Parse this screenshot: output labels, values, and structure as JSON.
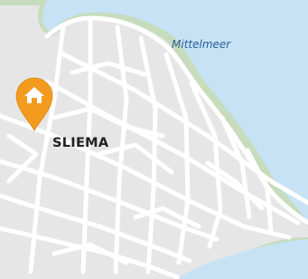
{
  "map": {
    "labels": {
      "sea": "Mittelmeer",
      "town": "SLIEMA"
    },
    "marker": {
      "icon": "home-icon",
      "color": "#f39b1f"
    },
    "colors": {
      "sea": "#c6e2f4",
      "land": "#e6e6e6",
      "coast": "#c6dcbc",
      "roads": "#ffffff",
      "water_label": "#2b5f98",
      "town_label": "#222222"
    }
  }
}
